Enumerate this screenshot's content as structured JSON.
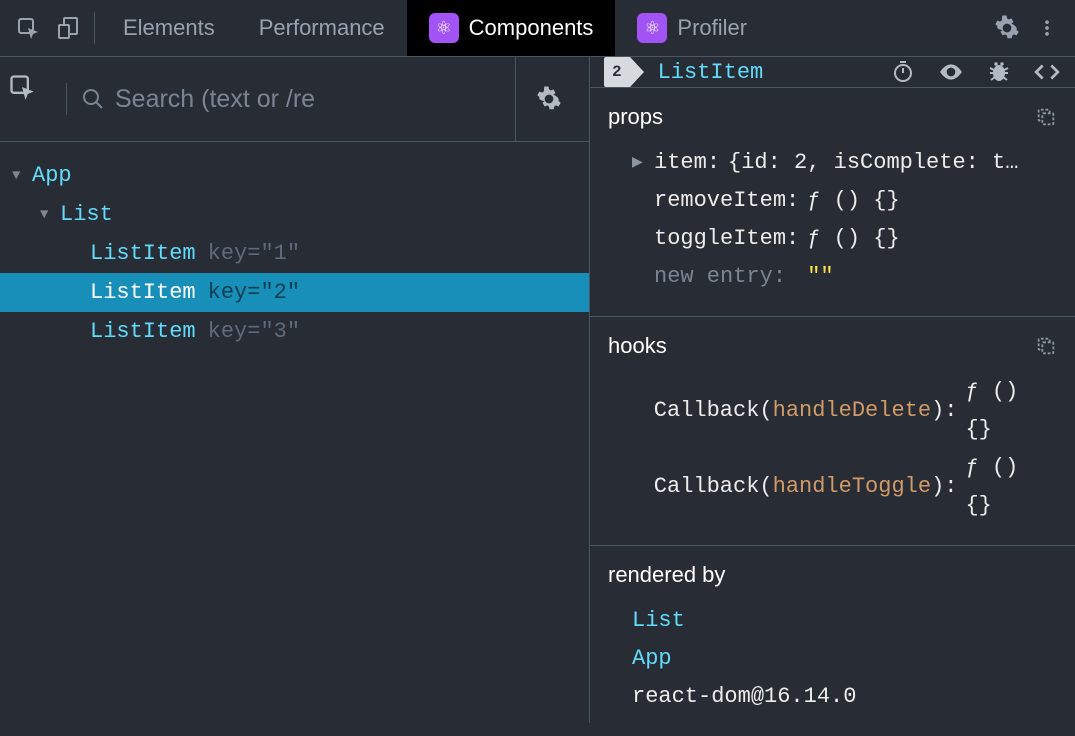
{
  "topbar": {
    "tabs": [
      {
        "label": "Elements",
        "active": false,
        "hasIcon": false
      },
      {
        "label": "Performance",
        "active": false,
        "hasIcon": false
      },
      {
        "label": "Components",
        "active": true,
        "hasIcon": true
      },
      {
        "label": "Profiler",
        "active": false,
        "hasIcon": true
      }
    ]
  },
  "left": {
    "search_placeholder": "Search (text or /re",
    "tree": {
      "root": "App",
      "children": [
        {
          "name": "List",
          "children": [
            {
              "name": "ListItem",
              "key": "\"1\"",
              "selected": false
            },
            {
              "name": "ListItem",
              "key": "\"2\"",
              "selected": true
            },
            {
              "name": "ListItem",
              "key": "\"3\"",
              "selected": false
            }
          ]
        }
      ]
    }
  },
  "right": {
    "badge": "2",
    "componentName": "ListItem",
    "props": {
      "title": "props",
      "items": [
        {
          "key": "item",
          "value": "{id: 2, isComplete: t…",
          "expandable": true
        },
        {
          "key": "removeItem",
          "value": "ƒ () {}",
          "expandable": false
        },
        {
          "key": "toggleItem",
          "value": "ƒ () {}",
          "expandable": false
        }
      ],
      "new_entry_label": "new entry",
      "new_entry_value": "\"\""
    },
    "hooks": {
      "title": "hooks",
      "items": [
        {
          "prefix": "Callback",
          "name": "handleDelete",
          "value": "ƒ () {}"
        },
        {
          "prefix": "Callback",
          "name": "handleToggle",
          "value": "ƒ () {}"
        }
      ]
    },
    "renderedBy": {
      "title": "rendered by",
      "entries": [
        "List",
        "App"
      ],
      "version": "react-dom@16.14.0"
    }
  }
}
